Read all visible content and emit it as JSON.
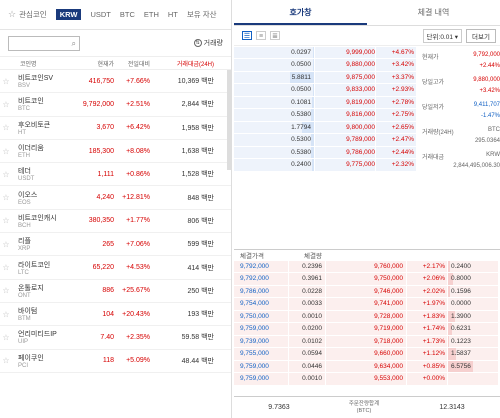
{
  "market_tabs": {
    "favorites": "관심코인",
    "tabs": [
      "KRW",
      "USDT",
      "BTC",
      "ETH",
      "HT",
      "보유 자산"
    ]
  },
  "search": {
    "placeholder": "",
    "volume_toggle": "거래량"
  },
  "list_header": {
    "name": "코인명",
    "price": "현재가",
    "change": "전일대비",
    "volume": "거래대금(24H)"
  },
  "coins": [
    {
      "name": "비트코인SV",
      "symbol": "BSV",
      "price": "416,750",
      "change": "+7.66%",
      "volume": "10,369 백만"
    },
    {
      "name": "비트코인",
      "symbol": "BTC",
      "price": "9,792,000",
      "change": "+2.51%",
      "volume": "2,844 백만"
    },
    {
      "name": "후오비토큰",
      "symbol": "HT",
      "price": "3,670",
      "change": "+6.42%",
      "volume": "1,958 백만"
    },
    {
      "name": "이더리움",
      "symbol": "ETH",
      "price": "185,300",
      "change": "+8.08%",
      "volume": "1,638 백만"
    },
    {
      "name": "테더",
      "symbol": "USDT",
      "price": "1,111",
      "change": "+0.86%",
      "volume": "1,528 백만"
    },
    {
      "name": "이오스",
      "symbol": "EOS",
      "price": "4,240",
      "change": "+12.81%",
      "volume": "848 백만"
    },
    {
      "name": "비트코인캐시",
      "symbol": "BCH",
      "price": "380,350",
      "change": "+1.77%",
      "volume": "806 백만"
    },
    {
      "name": "리플",
      "symbol": "XRP",
      "price": "265",
      "change": "+7.06%",
      "volume": "599 백만"
    },
    {
      "name": "라이트코인",
      "symbol": "LTC",
      "price": "65,220",
      "change": "+4.53%",
      "volume": "414 백만"
    },
    {
      "name": "온톨로지",
      "symbol": "ONT",
      "price": "886",
      "change": "+25.67%",
      "volume": "250 백만"
    },
    {
      "name": "바이텀",
      "symbol": "BTM",
      "price": "104",
      "change": "+20.43%",
      "volume": "193 백만"
    },
    {
      "name": "언리미티드IP",
      "symbol": "UIP",
      "price": "7.40",
      "change": "+2.35%",
      "volume": "59.58 백만"
    },
    {
      "name": "페이쿠인",
      "symbol": "PCI",
      "price": "118",
      "change": "+5.09%",
      "volume": "48.44 백만"
    }
  ],
  "right_tabs": [
    "호가창",
    "체결 내역"
  ],
  "toolbar": {
    "unit": "단위:0.01 ▾",
    "more": "더보기"
  },
  "asks": [
    {
      "qty": "0.0297",
      "price": "9,999,000",
      "rate": "+4.67%",
      "fill": 0.01
    },
    {
      "qty": "0.0500",
      "price": "9,880,000",
      "rate": "+3.42%",
      "fill": 0.01
    },
    {
      "qty": "5.8811",
      "price": "9,875,000",
      "rate": "+3.37%",
      "fill": 0.3
    },
    {
      "qty": "0.0500",
      "price": "9,833,000",
      "rate": "+2.93%",
      "fill": 0.01
    },
    {
      "qty": "0.1081",
      "price": "9,819,000",
      "rate": "+2.78%",
      "fill": 0.02
    },
    {
      "qty": "0.5380",
      "price": "9,816,000",
      "rate": "+2.75%",
      "fill": 0.04
    },
    {
      "qty": "1.7794",
      "price": "9,800,000",
      "rate": "+2.65%",
      "fill": 0.15
    },
    {
      "qty": "0.5300",
      "price": "9,789,000",
      "rate": "+2.47%",
      "fill": 0.04
    },
    {
      "qty": "0.5380",
      "price": "9,786,000",
      "rate": "+2.44%",
      "fill": 0.04
    },
    {
      "qty": "0.2400",
      "price": "9,775,000",
      "rate": "+2.32%",
      "fill": 0.02
    }
  ],
  "info": {
    "current_label": "현재가",
    "current": "9,792,000",
    "current_rate": "+2.44%",
    "high_label": "당일고가",
    "high": "9,880,000",
    "high_rate": "+3.42%",
    "low_label": "당일저가",
    "low": "9,411,707",
    "low_rate": "-1.47%",
    "vol_label": "거래량(24H)",
    "vol_unit": "BTC",
    "vol": "295.0364",
    "amt_label": "거래대금",
    "amt_unit": "KRW",
    "amt": "2,844,495,006.30"
  },
  "bid_header": {
    "price": "체결가격",
    "qty": "체결량"
  },
  "bids": [
    {
      "tp": "9,792,000",
      "tq": "0.2396",
      "price": "9,760,000",
      "rate": "+2.17%",
      "qty": "0.2400",
      "fill": 0.04
    },
    {
      "tp": "9,792,000",
      "tq": "0.3961",
      "price": "9,750,000",
      "rate": "+2.06%",
      "qty": "0.8000",
      "fill": 0.1
    },
    {
      "tp": "9,786,000",
      "tq": "0.0228",
      "price": "9,746,000",
      "rate": "+2.02%",
      "qty": "0.1596",
      "fill": 0.03
    },
    {
      "tp": "9,754,000",
      "tq": "0.0033",
      "price": "9,741,000",
      "rate": "+1.97%",
      "qty": "0.0000",
      "fill": 0.0
    },
    {
      "tp": "9,750,000",
      "tq": "0.0010",
      "price": "9,728,000",
      "rate": "+1.83%",
      "qty": "1.3900",
      "fill": 0.14
    },
    {
      "tp": "9,759,000",
      "tq": "0.0200",
      "price": "9,719,000",
      "rate": "+1.74%",
      "qty": "0.6231",
      "fill": 0.08
    },
    {
      "tp": "9,739,000",
      "tq": "0.0102",
      "price": "9,718,000",
      "rate": "+1.73%",
      "qty": "0.1223",
      "fill": 0.02
    },
    {
      "tp": "9,755,000",
      "tq": "0.0594",
      "price": "9,660,000",
      "rate": "+1.12%",
      "qty": "1.5837",
      "fill": 0.16
    },
    {
      "tp": "9,759,000",
      "tq": "0.0446",
      "price": "9,634,000",
      "rate": "+0.85%",
      "qty": "6.5756",
      "fill": 0.5
    },
    {
      "tp": "9,759,000",
      "tq": "0.0010",
      "price": "9,553,000",
      "rate": "+0.00%",
      "qty": "",
      "fill": 0.0
    }
  ],
  "footer": {
    "ask_total": "9.7363",
    "mid_label": "주문잔량합계",
    "mid_unit": "(BTC)",
    "bid_total": "12.3143"
  },
  "colors": {
    "up": "#d60000",
    "down": "#1261c4",
    "accent": "#1a3a7c"
  }
}
